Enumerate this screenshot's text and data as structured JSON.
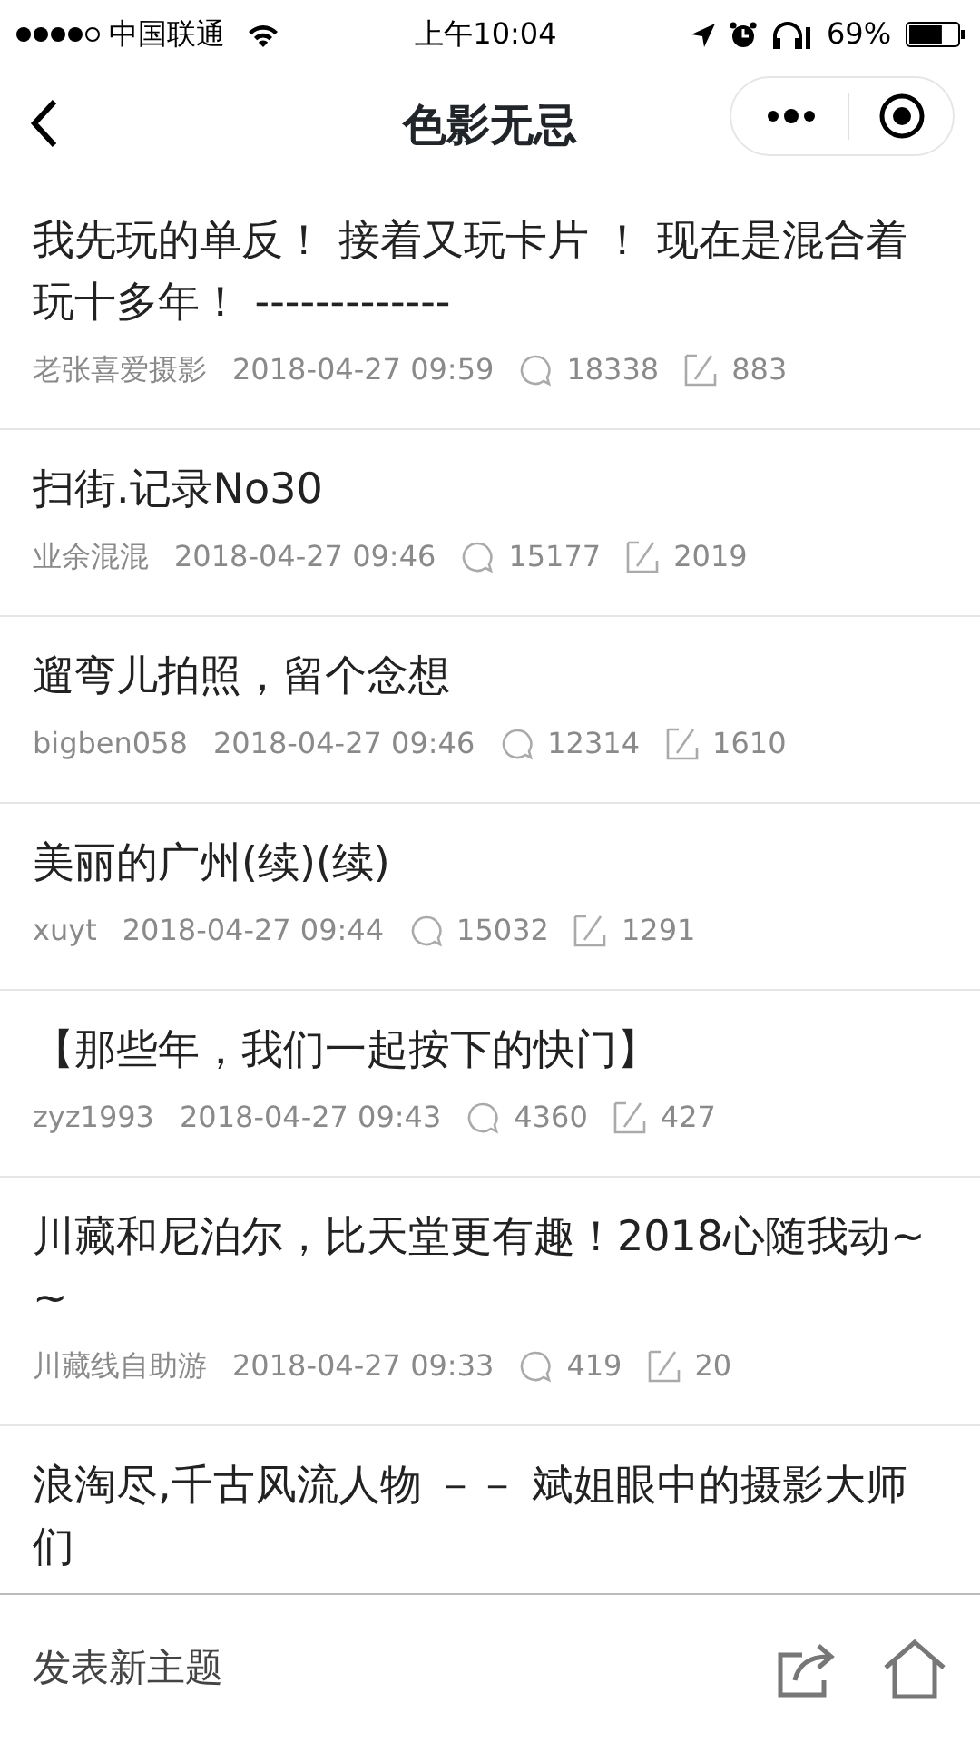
{
  "status_bar": {
    "carrier": "中国联通",
    "time": "上午10:04",
    "battery": "69%"
  },
  "nav": {
    "title": "色影无忌"
  },
  "posts": [
    {
      "title": "我先玩的单反！ 接着又玩卡片 ！ 现在是混合着玩十多年！ -------------",
      "author": "老张喜爱摄影",
      "date": "2018-04-27 09:59",
      "views": "18338",
      "replies": "883"
    },
    {
      "title": "扫街.记录No30",
      "author": "业余混混",
      "date": "2018-04-27 09:46",
      "views": "15177",
      "replies": "2019"
    },
    {
      "title": "遛弯儿拍照，留个念想",
      "author": "bigben058",
      "date": "2018-04-27 09:46",
      "views": "12314",
      "replies": "1610"
    },
    {
      "title": "美丽的广州(续)(续)",
      "author": "xuyt",
      "date": "2018-04-27 09:44",
      "views": "15032",
      "replies": "1291"
    },
    {
      "title": "【那些年，我们一起按下的快门】",
      "author": "zyz1993",
      "date": "2018-04-27 09:43",
      "views": "4360",
      "replies": "427"
    },
    {
      "title": "川藏和尼泊尔，比天堂更有趣！2018心随我动~ ~",
      "author": "川藏线自助游",
      "date": "2018-04-27 09:33",
      "views": "419",
      "replies": "20"
    },
    {
      "title": "浪淘尽,千古风流人物 －－ 斌姐眼中的摄影大师们"
    }
  ],
  "bottom_bar": {
    "new_topic": "发表新主题"
  }
}
